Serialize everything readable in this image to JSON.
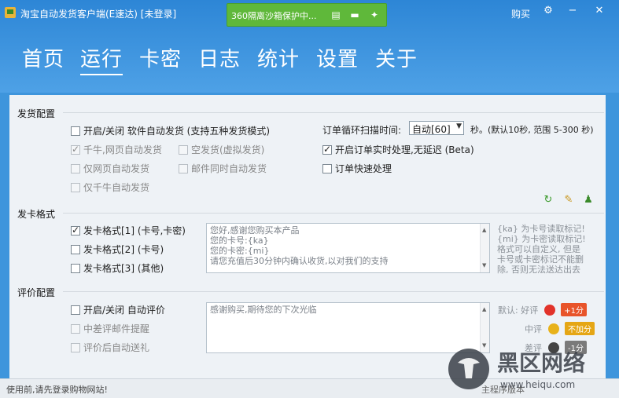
{
  "window": {
    "title": "淘宝自动发货客户端(E速达) [未登录]",
    "sandbox_label": "360隔离沙箱保护中...",
    "buy_label": "购买"
  },
  "nav": [
    "首页",
    "运行",
    "卡密",
    "日志",
    "统计",
    "设置",
    "关于"
  ],
  "active_tab": "运行",
  "shipping": {
    "title": "发货配置",
    "toggle_label": "开启/关闭 软件自动发货 (支持五种发货模式)",
    "modes": {
      "qianniu_web": "千牛,网页自动发货",
      "empty_ship": "空发货(虚拟发货)",
      "web_only": "仅网页自动发货",
      "email_sync": "邮件同时自动发货",
      "qianniu_only": "仅千牛自动发货"
    },
    "scan_label": "订单循环扫描时间:",
    "scan_value": "自动[60]",
    "scan_unit": "秒。(默认10秒, 范围 5-300 秒)",
    "realtime_label": "开启订单实时处理,无延迟 (Beta)",
    "quick_label": "订单快速处理"
  },
  "card_format": {
    "title": "发卡格式",
    "formats": [
      "发卡格式[1] (卡号,卡密)",
      "发卡格式[2] (卡号)",
      "发卡格式[3] (其他)"
    ],
    "template_lines": [
      "您好,感谢您购买本产品",
      "您的卡号:{ka}",
      "您的卡密:{mi}",
      "请您充值后30分钟内确认收货,以对我们的支持"
    ],
    "hint_lines": [
      "{ka} 为卡号读取标记!",
      "{mi} 为卡密读取标记!",
      "格式可以自定义, 但是",
      "卡号或卡密标记不能删",
      "除, 否则无法送达出去"
    ]
  },
  "review": {
    "title": "评价配置",
    "toggle_label": "开启/关闭 自动评价",
    "email_alert": "中差评邮件提醒",
    "auto_gift": "评价后自动送礼",
    "template": "感谢购买,期待您的下次光临",
    "default_label": "默认:",
    "good": {
      "label": "好评",
      "badge": "+1分"
    },
    "neutral": {
      "label": "中评",
      "badge": "不加分"
    },
    "bad": {
      "label": "差评",
      "badge": "-1分"
    }
  },
  "status": {
    "message": "使用前,请先登录购物网站!",
    "right_text": "主程序版本",
    "watermark_cn": "黑区网络",
    "watermark_url": "www.heiqu.com"
  }
}
